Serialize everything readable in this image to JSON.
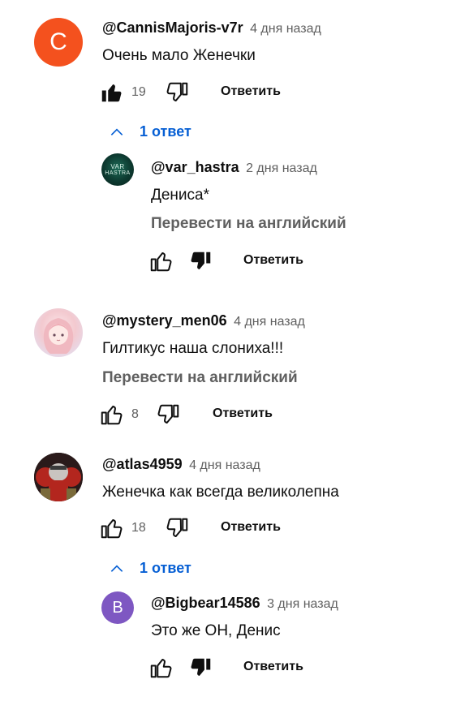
{
  "comments": [
    {
      "author": "@CannisMajoris-v7r",
      "time": "4 дня назад",
      "text": "Очень мало Женечки",
      "likes": "19",
      "reply_label": "Ответить",
      "avatar_letter": "C",
      "avatar_color": "#f4511e",
      "liked": true,
      "replies_toggle": "1 ответ",
      "replies": [
        {
          "author": "@var_hastra",
          "time": "2 дня назад",
          "text": "Дениса*",
          "translate": "Перевести на английский",
          "reply_label": "Ответить",
          "avatar_text_1": "VAR",
          "avatar_text_2": "HASTRA",
          "disliked": true
        }
      ]
    },
    {
      "author": "@mystery_men06",
      "time": "4 дня назад",
      "text": "Гилтикус наша слониха!!!",
      "translate": "Перевести на английский",
      "likes": "8",
      "reply_label": "Ответить"
    },
    {
      "author": "@atlas4959",
      "time": "4 дня назад",
      "text": "Женечка как всегда великолепна",
      "likes": "18",
      "reply_label": "Ответить",
      "replies_toggle": "1 ответ",
      "replies": [
        {
          "author": "@Bigbear14586",
          "time": "3 дня назад",
          "text": "Это же ОН, Денис",
          "reply_label": "Ответить",
          "avatar_letter": "B",
          "avatar_color": "#7e57c2",
          "disliked": true
        }
      ]
    }
  ],
  "colors": {
    "link": "#065fd4",
    "meta": "#606060",
    "text": "#0f0f0f"
  }
}
